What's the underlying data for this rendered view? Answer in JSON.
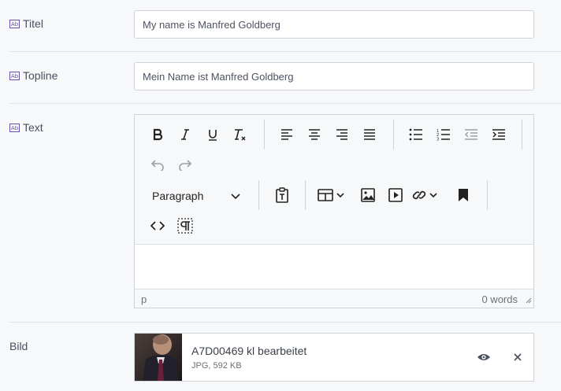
{
  "fields": {
    "title": {
      "label": "Titel",
      "value": "My name is Manfred Goldberg"
    },
    "topline": {
      "label": "Topline",
      "value": "Mein Name ist Manfred Goldberg"
    },
    "text": {
      "label": "Text"
    },
    "image": {
      "label": "Bild"
    }
  },
  "editor": {
    "block_format": "Paragraph",
    "status_path": "p",
    "word_count": "0 words",
    "toolbar_icons": [
      "bold-icon",
      "italic-icon",
      "underline-icon",
      "clear-formatting-icon",
      "align-left-icon",
      "align-center-icon",
      "align-right-icon",
      "align-justify-icon",
      "bullet-list-icon",
      "numbered-list-icon",
      "outdent-icon",
      "indent-icon",
      "undo-icon",
      "redo-icon",
      "paste-text-icon",
      "table-icon",
      "image-icon",
      "media-icon",
      "link-icon",
      "anchor-icon",
      "source-code-icon",
      "show-blocks-icon"
    ]
  },
  "file": {
    "name": "A7D00469 kl bearbeitet",
    "meta": "JPG, 592 KB"
  }
}
